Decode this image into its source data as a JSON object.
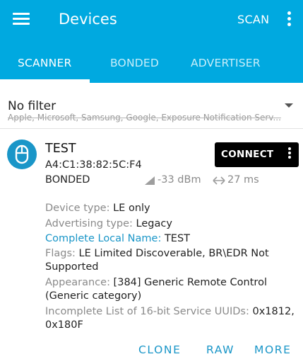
{
  "colors": {
    "primary": "#00a9e0",
    "accent": "#1a96c8",
    "connect_bg": "#000000"
  },
  "toolbar": {
    "title": "Devices",
    "scan_label": "SCAN",
    "menu_icon": "hamburger-icon",
    "overflow_icon": "more-vert-icon"
  },
  "tabs": [
    {
      "label": "SCANNER",
      "active": true
    },
    {
      "label": "BONDED",
      "active": false
    },
    {
      "label": "ADVERTISER",
      "active": false
    }
  ],
  "filter": {
    "title": "No filter",
    "subtitle": "Apple, Microsoft, Samsung, Google, Exposure Notification Serv..."
  },
  "device": {
    "name": "TEST",
    "address": "A4:C1:38:82:5C:F4",
    "bond_state": "BONDED",
    "rssi": "-33 dBm",
    "interval": "27 ms",
    "connect_label": "CONNECT",
    "icon": "mouse-icon"
  },
  "details": [
    {
      "key": "Device type:",
      "value": " LE only"
    },
    {
      "key": "Advertising type:",
      "value": " Legacy"
    },
    {
      "key": "Complete Local Name:",
      "value": " TEST"
    },
    {
      "key": "Flags:",
      "value": " LE Limited Discoverable, BR\\EDR Not Supported"
    },
    {
      "key": "Appearance:",
      "value": " [384] Generic Remote Control (Generic category)"
    },
    {
      "key": "Incomplete List of 16-bit Service UUIDs:",
      "value": " 0x1812, 0x180F"
    }
  ],
  "actions": {
    "clone": "CLONE",
    "raw": "RAW",
    "more": "MORE"
  }
}
